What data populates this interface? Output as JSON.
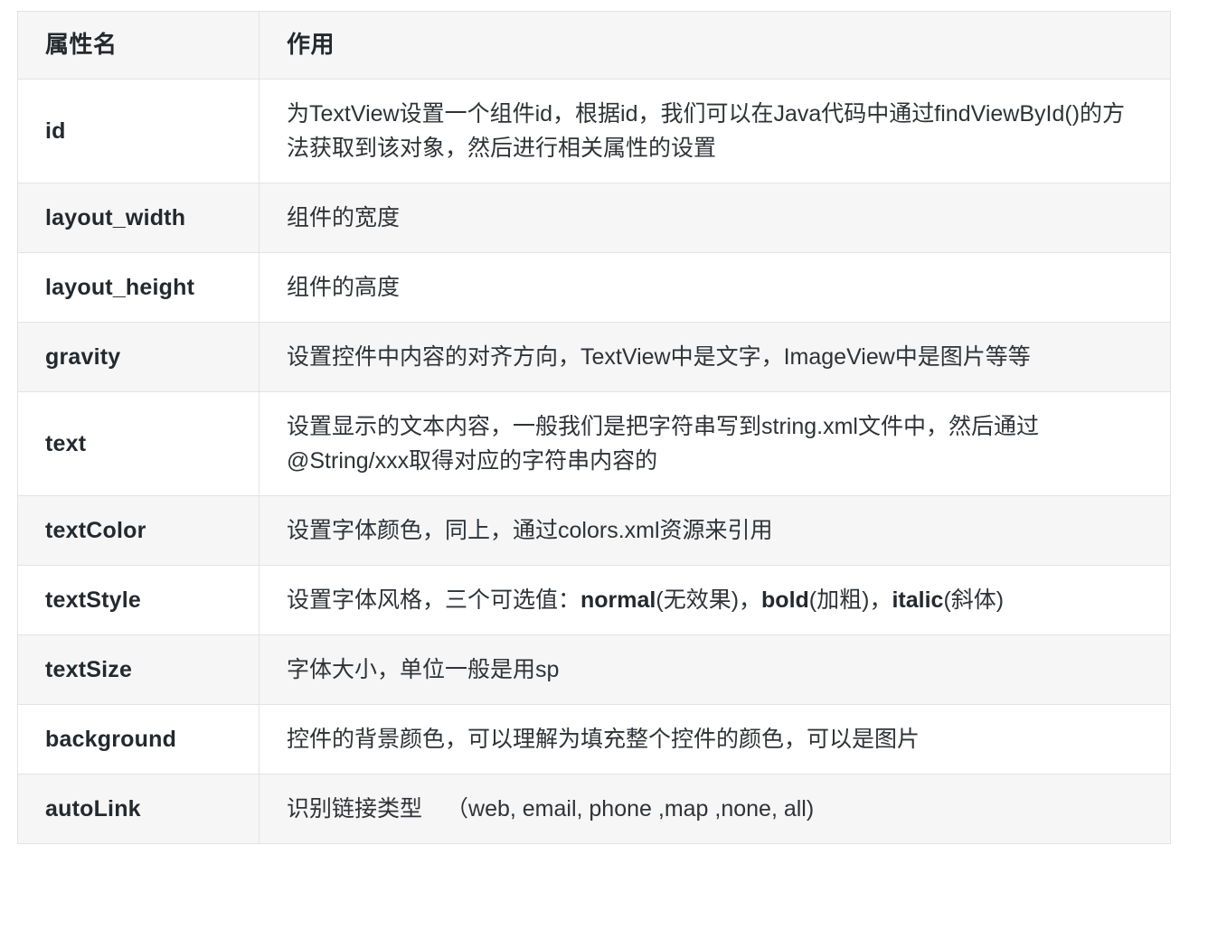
{
  "table": {
    "headers": {
      "name": "属性名",
      "desc": "作用"
    },
    "rows": [
      {
        "name": "id",
        "desc": "为TextView设置一个组件id，根据id，我们可以在Java代码中通过findViewById()的方法获取到该对象，然后进行相关属性的设置"
      },
      {
        "name": "layout_width",
        "desc": "组件的宽度"
      },
      {
        "name": "layout_height",
        "desc": "组件的高度"
      },
      {
        "name": "gravity",
        "desc": "设置控件中内容的对齐方向，TextView中是文字，ImageView中是图片等等"
      },
      {
        "name": "text",
        "desc": "设置显示的文本内容，一般我们是把字符串写到string.xml文件中，然后通过@String/xxx取得对应的字符串内容的"
      },
      {
        "name": "textColor",
        "desc": "设置字体颜色，同上，通过colors.xml资源来引用"
      },
      {
        "name": "textStyle",
        "desc_parts": {
          "lead": "设置字体风格，三个可选值：",
          "term1": "normal",
          "mid1": "(无效果)，",
          "term2": "bold",
          "mid2": "(加粗)，",
          "term3": "italic",
          "tail": "(斜体)"
        },
        "desc": "设置字体风格，三个可选值：normal(无效果)，bold(加粗)，italic(斜体)"
      },
      {
        "name": "textSize",
        "desc": "字体大小，单位一般是用sp"
      },
      {
        "name": "background",
        "desc": "控件的背景颜色，可以理解为填充整个控件的颜色，可以是图片"
      },
      {
        "name": "autoLink",
        "desc_parts": {
          "lead": "识别链接类型",
          "tail": "（web, email, phone ,map ,none, all)"
        },
        "desc": "识别链接类型　（web, email, phone ,map ,none, all)"
      }
    ]
  },
  "colors": {
    "stripe": "#f6f6f6",
    "border": "#e3e3e3",
    "text": "#2f3337",
    "heading": "#24292e",
    "background": "#ffffff"
  }
}
